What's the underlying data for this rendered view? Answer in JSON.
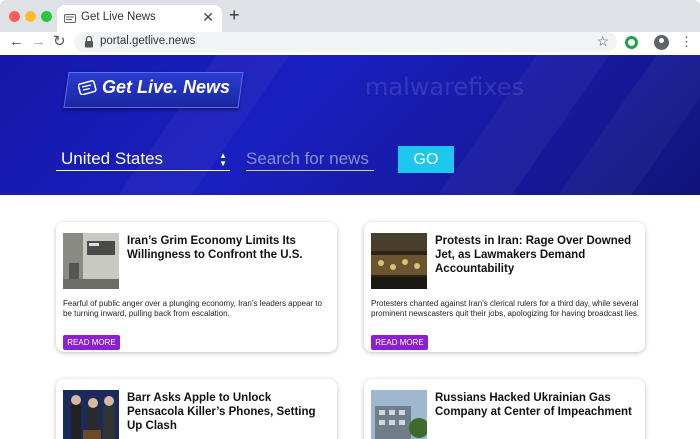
{
  "browser": {
    "tab_title": "Get Live News",
    "tab_close": "✕",
    "new_tab": "+",
    "back": "←",
    "forward": "→",
    "reload": "↻",
    "url": "portal.getlive.news",
    "bookmark": "☆",
    "menu": "⋮"
  },
  "hero": {
    "logo": "Get Live. News",
    "watermark": "malwarefixes",
    "country": "United States",
    "search_placeholder": "Search for news",
    "go_label": "GO"
  },
  "articles": [
    {
      "headline": "Iran’s Grim Economy Limits Its Willingness to Confront the U.S.",
      "description": "Fearful of public anger over a plunging economy, Iran’s leaders appear to be turning inward, pulling back from escalation.",
      "read_more": "READ MORE"
    },
    {
      "headline": "Protests in Iran: Rage Over Downed Jet, as Lawmakers Demand Accountability",
      "description": "Protesters chanted against Iran’s clerical rulers for a third day, while several prominent newscasters quit their jobs, apologizing for having broadcast lies.",
      "read_more": "READ MORE"
    },
    {
      "headline": "Barr Asks Apple to Unlock Pensacola Killer’s Phones, Setting Up Clash",
      "description": "",
      "read_more": ""
    },
    {
      "headline": "Russians Hacked Ukrainian Gas Company at Center of Impeachment",
      "description": "",
      "read_more": ""
    }
  ],
  "colors": {
    "hero_bg": "#1418a8",
    "go_button": "#1ec7ee",
    "read_more": "#8b1fd4"
  }
}
